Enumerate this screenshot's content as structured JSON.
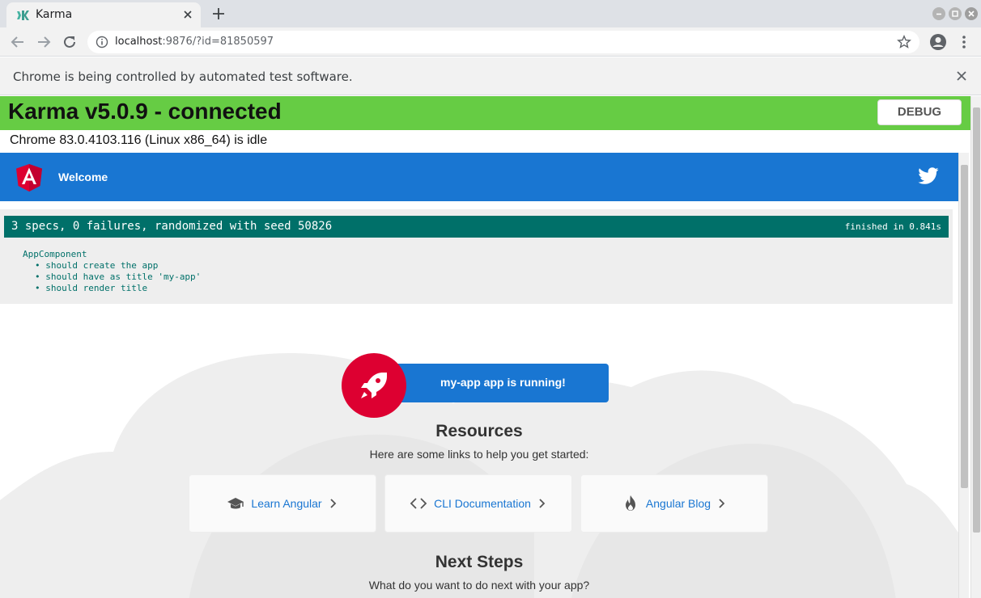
{
  "browser": {
    "tab_title": "Karma",
    "url_host": "localhost",
    "url_rest": ":9876/?id=81850597",
    "infobar_text": "Chrome is being controlled by automated test software."
  },
  "karma": {
    "title": "Karma v5.0.9 - connected",
    "debug_label": "DEBUG",
    "status": "Chrome 83.0.4103.116 (Linux x86_64) is idle",
    "banner_color": "#66cc44"
  },
  "app": {
    "toolbar_title": "Welcome",
    "running_text": "my-app app is running!",
    "resources_title": "Resources",
    "resources_subtitle": "Here are some links to help you get started:",
    "resources": [
      {
        "label": "Learn Angular",
        "icon": "graduation-cap-icon"
      },
      {
        "label": "CLI Documentation",
        "icon": "code-brackets-icon"
      },
      {
        "label": "Angular Blog",
        "icon": "flame-icon"
      }
    ],
    "next_title": "Next Steps",
    "next_subtitle": "What do you want to do next with your app?",
    "accent_color": "#1976d2",
    "brand_red": "#dd0031"
  },
  "jasmine": {
    "summary": "3 specs, 0 failures, randomized with seed 50826",
    "duration": "finished in 0.841s",
    "suite": "AppComponent",
    "specs": [
      "should create the app",
      "should have as title 'my-app'",
      "should render title"
    ],
    "bar_color": "#007069"
  }
}
